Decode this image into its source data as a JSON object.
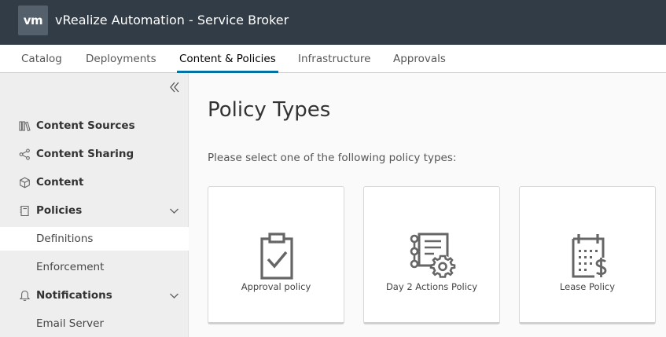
{
  "header": {
    "logo_text": "vm",
    "app_title": "vRealize Automation - Service Broker"
  },
  "tabs": [
    {
      "label": "Catalog",
      "active": false
    },
    {
      "label": "Deployments",
      "active": false
    },
    {
      "label": "Content & Policies",
      "active": true
    },
    {
      "label": "Infrastructure",
      "active": false
    },
    {
      "label": "Approvals",
      "active": false
    }
  ],
  "sidebar": {
    "collapse_icon": "double-chevron-left-icon",
    "items": [
      {
        "label": "Content Sources",
        "icon": "library-icon"
      },
      {
        "label": "Content Sharing",
        "icon": "share-icon"
      },
      {
        "label": "Content",
        "icon": "cube-icon"
      },
      {
        "label": "Policies",
        "icon": "clipboard-icon",
        "expanded": true
      },
      {
        "label": "Definitions",
        "sub": true,
        "selected": true
      },
      {
        "label": "Enforcement",
        "sub": true
      },
      {
        "label": "Notifications",
        "icon": "bell-icon",
        "expanded": true
      },
      {
        "label": "Email Server",
        "sub": true
      }
    ]
  },
  "main": {
    "title": "Policy Types",
    "subtitle": "Please select one of the following policy types:",
    "cards": [
      {
        "label": "Approval policy",
        "icon": "clipboard-check-icon"
      },
      {
        "label": "Day 2 Actions Policy",
        "icon": "checklist-gear-icon"
      },
      {
        "label": "Lease Policy",
        "icon": "calendar-dollar-icon"
      }
    ]
  },
  "colors": {
    "header_bg": "#313c47",
    "tab_active_underline": "#0072a3",
    "sidebar_bg": "#eeeeee",
    "icon_gray": "#666666"
  }
}
